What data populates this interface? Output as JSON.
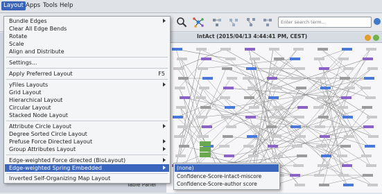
{
  "menubar": {
    "items": [
      "Layout",
      "Apps",
      "Tools",
      "Help"
    ]
  },
  "toolbar": {
    "search_placeholder": "Enter search term..."
  },
  "network": {
    "title": "IntAct (2015/04/13 4:44:41 PM, CEST)"
  },
  "table_panel": {
    "label": "Table Panel"
  },
  "layout_menu": {
    "items": [
      {
        "label": "Bundle Edges",
        "submenu": true
      },
      {
        "label": "Clear All Edge Bends"
      },
      {
        "label": "Rotate"
      },
      {
        "label": "Scale"
      },
      {
        "label": "Align and Distribute"
      },
      {
        "label": "Settings..."
      },
      {
        "label": "Apply Preferred Layout",
        "accelerator": "F5"
      },
      {
        "label": "yFiles Layouts",
        "submenu": true
      },
      {
        "label": "Grid Layout"
      },
      {
        "label": "Hierarchical Layout"
      },
      {
        "label": "Circular Layout"
      },
      {
        "label": "Stacked Node Layout"
      },
      {
        "label": "Attribute Circle Layout",
        "submenu": true
      },
      {
        "label": "Degree Sorted Circle Layout"
      },
      {
        "label": "Prefuse Force Directed Layout",
        "submenu": true
      },
      {
        "label": "Group Attributes Layout",
        "submenu": true
      },
      {
        "label": "Edge-weighted Force directed (BioLayout)",
        "submenu": true
      },
      {
        "label": "Edge-weighted Spring Embedded",
        "submenu": true
      },
      {
        "label": "Inverted Self-Organizing Map Layout"
      }
    ]
  },
  "submenu": {
    "items": [
      "(none)",
      "Confidence-Score-intact-miscore",
      "Confidence-Score-author score"
    ]
  },
  "colors": {
    "highlight": "#3b66bd",
    "node_blue": "#4a78d8",
    "node_purple": "#8a63c7",
    "node_green": "#6aa84f"
  }
}
